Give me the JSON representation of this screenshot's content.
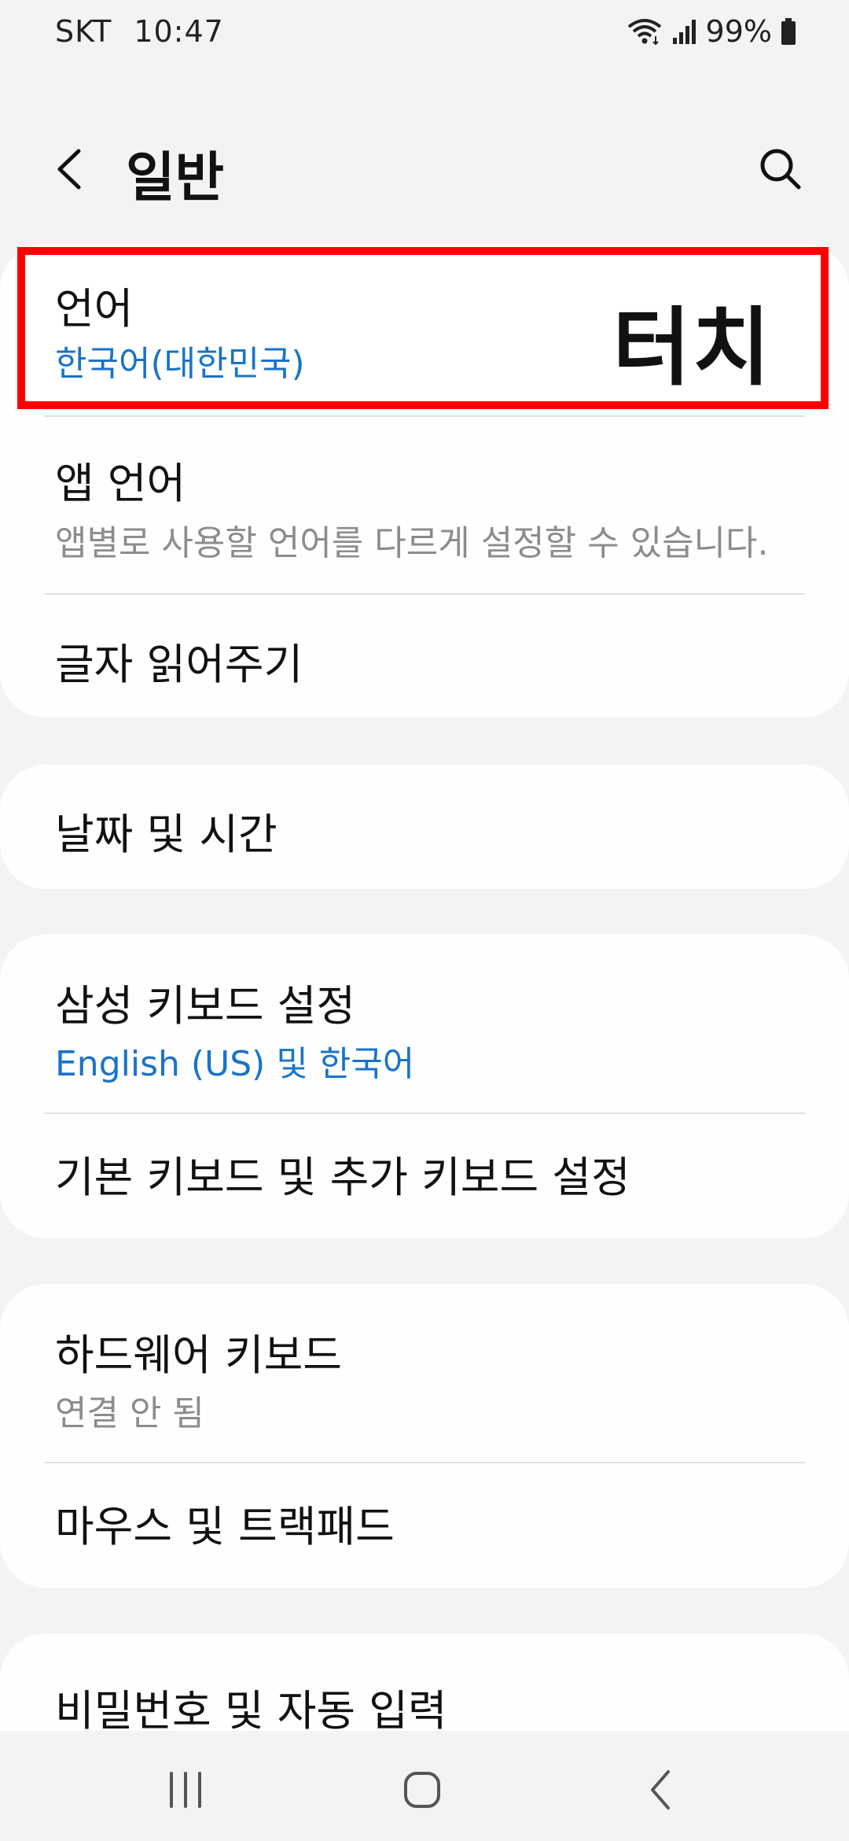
{
  "status_bar": {
    "carrier": "SKT",
    "time": "10:47",
    "battery": "99%"
  },
  "header": {
    "title": "일반"
  },
  "annotation": {
    "label": "터치",
    "color": "#ff0000"
  },
  "colors": {
    "accent": "#1a73c8",
    "secondary_text": "#8c8c8c"
  },
  "items": [
    {
      "title": "언어",
      "subtitle": "한국어(대한민국)"
    },
    {
      "title": "앱 언어",
      "subtitle": "앱별로 사용할 언어를 다르게 설정할 수 있습니다."
    },
    {
      "title": "글자 읽어주기"
    },
    {
      "title": "날짜 및 시간"
    },
    {
      "title": "삼성 키보드 설정",
      "subtitle": "English (US) 및 한국어"
    },
    {
      "title": "기본 키보드 및 추가 키보드 설정"
    },
    {
      "title": "하드웨어 키보드",
      "subtitle": "연결 안 됨"
    },
    {
      "title": "마우스 및 트랙패드"
    },
    {
      "title": "비밀번호 및 자동 입력"
    }
  ],
  "nav_icons": [
    "recents-icon",
    "home-icon",
    "back-icon"
  ]
}
